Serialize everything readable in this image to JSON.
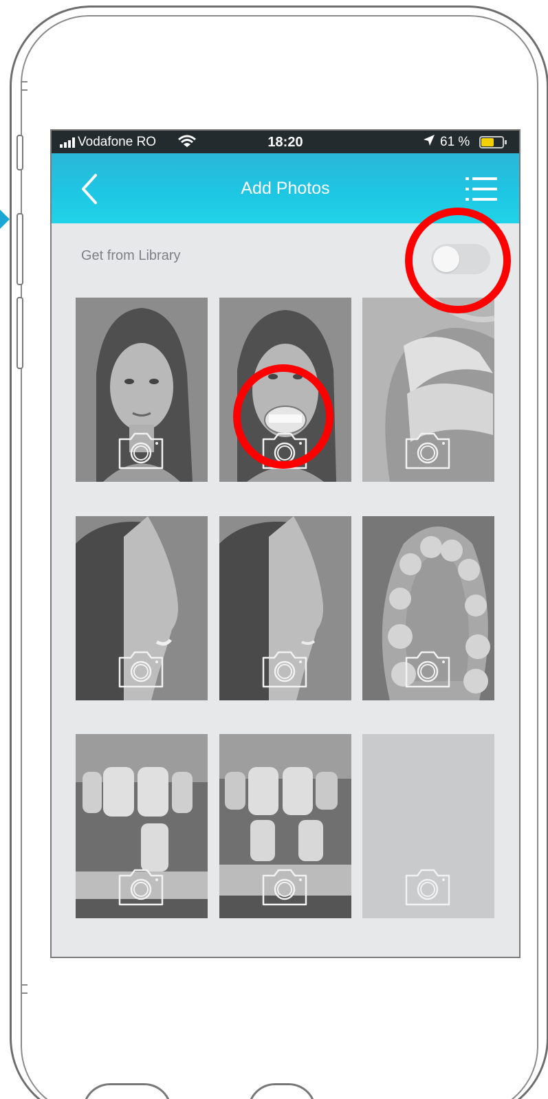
{
  "status_bar": {
    "carrier": "Vodafone RO",
    "time": "18:20",
    "battery_percent": "61 %",
    "battery_level": 0.61,
    "icons": [
      "signal-icon",
      "wifi-icon",
      "location-arrow-icon",
      "battery-icon"
    ]
  },
  "nav": {
    "title": "Add Photos",
    "back_icon": "chevron-left-icon",
    "menu_icon": "list-menu-icon"
  },
  "library": {
    "label": "Get from Library",
    "toggle_on": false
  },
  "photos": [
    {
      "slot": 1,
      "content": "face-frontal",
      "camera_icon": "camera-icon"
    },
    {
      "slot": 2,
      "content": "face-frontal-smile-retractor",
      "camera_icon": "camera-icon"
    },
    {
      "slot": 3,
      "content": "intraoral-lateral",
      "camera_icon": "camera-icon"
    },
    {
      "slot": 4,
      "content": "face-profile-smile",
      "camera_icon": "camera-icon"
    },
    {
      "slot": 5,
      "content": "face-profile",
      "camera_icon": "camera-icon"
    },
    {
      "slot": 6,
      "content": "occlusal-upper-arch",
      "camera_icon": "camera-icon"
    },
    {
      "slot": 7,
      "content": "teeth-shade-tab-single",
      "camera_icon": "camera-icon"
    },
    {
      "slot": 8,
      "content": "teeth-shade-tab-double",
      "camera_icon": "camera-icon"
    },
    {
      "slot": 9,
      "content": "empty",
      "camera_icon": "camera-icon"
    }
  ],
  "colors": {
    "nav_gradient_start": "#2bb6d8",
    "nav_gradient_end": "#20d3e8",
    "status_bar": "#232b2e",
    "screen_bg": "#e7e8ea",
    "annotation": "#ff0000",
    "battery_fill": "#f3d000"
  }
}
